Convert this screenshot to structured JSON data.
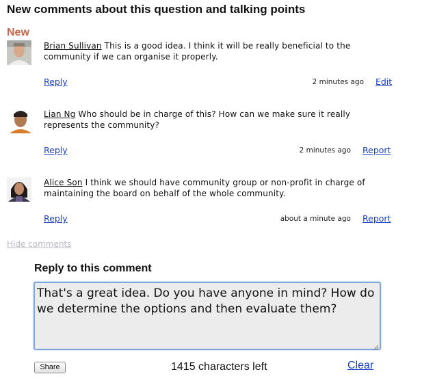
{
  "section": {
    "title": "New comments about this question and talking points",
    "new_label": "New"
  },
  "comments": [
    {
      "author": "Brian Sullivan",
      "text": "This is a good idea. I think it will be really beneficial to the community if we can organise it properly.",
      "reply_label": "Reply",
      "timestamp": "2 minutes ago",
      "action_label": "Edit"
    },
    {
      "author": "Lian Ng",
      "text": "Who should be in charge of this? How can we make sure it really represents the community?",
      "reply_label": "Reply",
      "timestamp": "2 minutes ago",
      "action_label": "Report"
    },
    {
      "author": "Alice Son",
      "text": "I think we should have community group or non-profit in charge of maintaining the board on behalf of the whole community.",
      "reply_label": "Reply",
      "timestamp": "about a minute ago",
      "action_label": "Report"
    }
  ],
  "hide_comments_label": "Hide comments",
  "reply_form": {
    "heading": "Reply to this comment",
    "value": "That's a great idea. Do you have anyone in mind? How do we determine the options and then evaluate them?",
    "share_label": "Share",
    "chars_left": "1415 characters left",
    "clear_label": "Clear"
  }
}
